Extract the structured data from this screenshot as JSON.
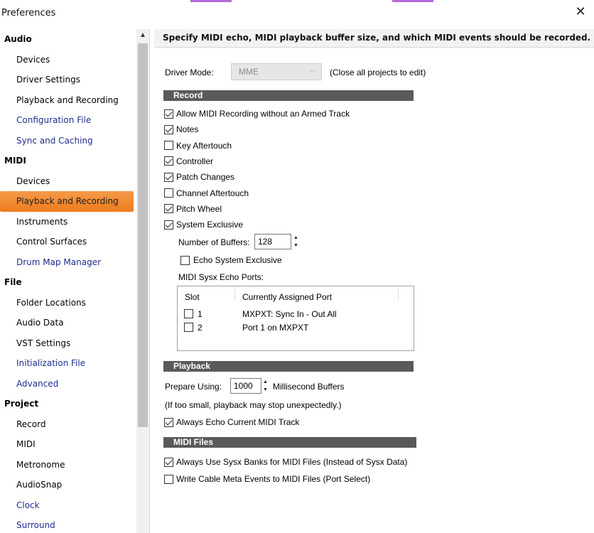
{
  "window": {
    "title": "Preferences",
    "close_icon": "close-icon"
  },
  "colors": {
    "selected_start": "#f59a4a",
    "selected_end": "#ee7b1c",
    "link": "#1f2d8f",
    "section_bar": "#5a5a5a",
    "top_accent": "#b46ad6"
  },
  "sidebar": {
    "groups": [
      {
        "label": "Audio",
        "items": [
          {
            "label": "Devices",
            "style": "normal"
          },
          {
            "label": "Driver Settings",
            "style": "normal"
          },
          {
            "label": "Playback and Recording",
            "style": "normal"
          },
          {
            "label": "Configuration File",
            "style": "link"
          },
          {
            "label": "Sync and Caching",
            "style": "link"
          }
        ]
      },
      {
        "label": "MIDI",
        "items": [
          {
            "label": "Devices",
            "style": "normal"
          },
          {
            "label": "Playback and Recording",
            "style": "selected"
          },
          {
            "label": "Instruments",
            "style": "normal"
          },
          {
            "label": "Control Surfaces",
            "style": "normal"
          },
          {
            "label": "Drum Map Manager",
            "style": "link"
          }
        ]
      },
      {
        "label": "File",
        "items": [
          {
            "label": "Folder Locations",
            "style": "normal"
          },
          {
            "label": "Audio Data",
            "style": "normal"
          },
          {
            "label": "VST Settings",
            "style": "normal"
          },
          {
            "label": "Initialization File",
            "style": "link"
          },
          {
            "label": "Advanced",
            "style": "link"
          }
        ]
      },
      {
        "label": "Project",
        "items": [
          {
            "label": "Record",
            "style": "normal"
          },
          {
            "label": "MIDI",
            "style": "normal"
          },
          {
            "label": "Metronome",
            "style": "normal"
          },
          {
            "label": "AudioSnap",
            "style": "normal"
          },
          {
            "label": "Clock",
            "style": "link"
          },
          {
            "label": "Surround",
            "style": "link"
          }
        ]
      }
    ]
  },
  "content": {
    "header": "Specify MIDI echo, MIDI playback buffer size, and which MIDI events should be recorded.",
    "driver_mode": {
      "label": "Driver Mode:",
      "value": "MME",
      "note": "(Close all projects to edit)"
    },
    "record": {
      "title": "Record",
      "options": [
        {
          "label": "Allow MIDI Recording without an Armed Track",
          "checked": true
        },
        {
          "label": "Notes",
          "checked": true
        },
        {
          "label": "Key Aftertouch",
          "checked": false
        },
        {
          "label": "Controller",
          "checked": true
        },
        {
          "label": "Patch Changes",
          "checked": true
        },
        {
          "label": "Channel Aftertouch",
          "checked": false
        },
        {
          "label": "Pitch Wheel",
          "checked": true
        },
        {
          "label": "System Exclusive",
          "checked": true
        }
      ],
      "buffers": {
        "label": "Number of Buffers:",
        "value": "128"
      },
      "echo_sysx": {
        "label": "Echo System Exclusive",
        "checked": false
      },
      "echo_ports": {
        "label": "MIDI Sysx Echo Ports:",
        "columns": [
          "Slot",
          "Currently Assigned Port"
        ],
        "rows": [
          {
            "slot": "1",
            "port": "MXPXT: Sync In - Out All",
            "checked": false
          },
          {
            "slot": "2",
            "port": "Port 1 on MXPXT",
            "checked": false
          }
        ]
      }
    },
    "playback": {
      "title": "Playback",
      "prepare_label": "Prepare Using:",
      "prepare_value": "1000",
      "prepare_unit": "Millisecond Buffers",
      "note": "(If too small, playback may stop unexpectedly.)",
      "always_echo": {
        "label": "Always Echo Current MIDI Track",
        "checked": true
      }
    },
    "midi_files": {
      "title": "MIDI Files",
      "options": [
        {
          "label": "Always Use Sysx Banks for MIDI Files (Instead of Sysx Data)",
          "checked": true
        },
        {
          "label": "Write Cable Meta Events to MIDI Files (Port Select)",
          "checked": false
        }
      ]
    }
  }
}
